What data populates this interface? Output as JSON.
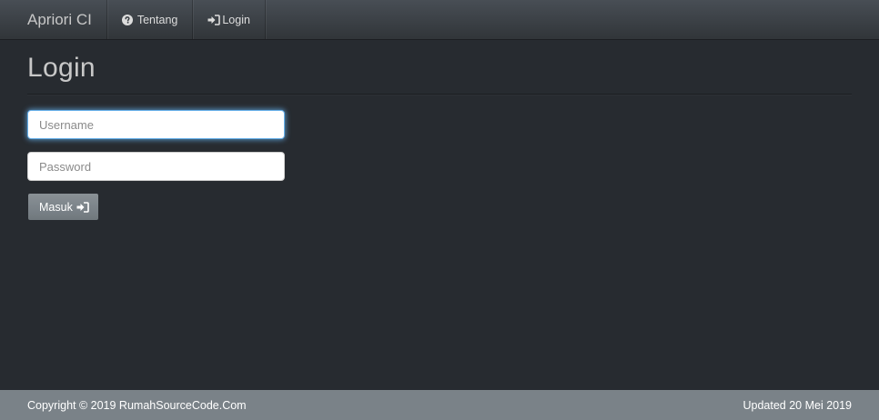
{
  "navbar": {
    "brand": "Apriori CI",
    "items": [
      {
        "label": "Tentang",
        "icon": "question-circle-icon"
      },
      {
        "label": "Login",
        "icon": "sign-in-icon"
      }
    ]
  },
  "page": {
    "title": "Login"
  },
  "form": {
    "username_placeholder": "Username",
    "password_placeholder": "Password",
    "submit_label": "Masuk",
    "submit_icon": "sign-in-icon"
  },
  "footer": {
    "copyright": "Copyright © 2019 RumahSourceCode.Com",
    "updated": "Updated 20 Mei 2019"
  },
  "colors": {
    "background": "#272b30",
    "navbar": "#3a3f44",
    "footer": "#7a8288",
    "button": "#7a8288",
    "focus_glow": "#66afe9"
  }
}
